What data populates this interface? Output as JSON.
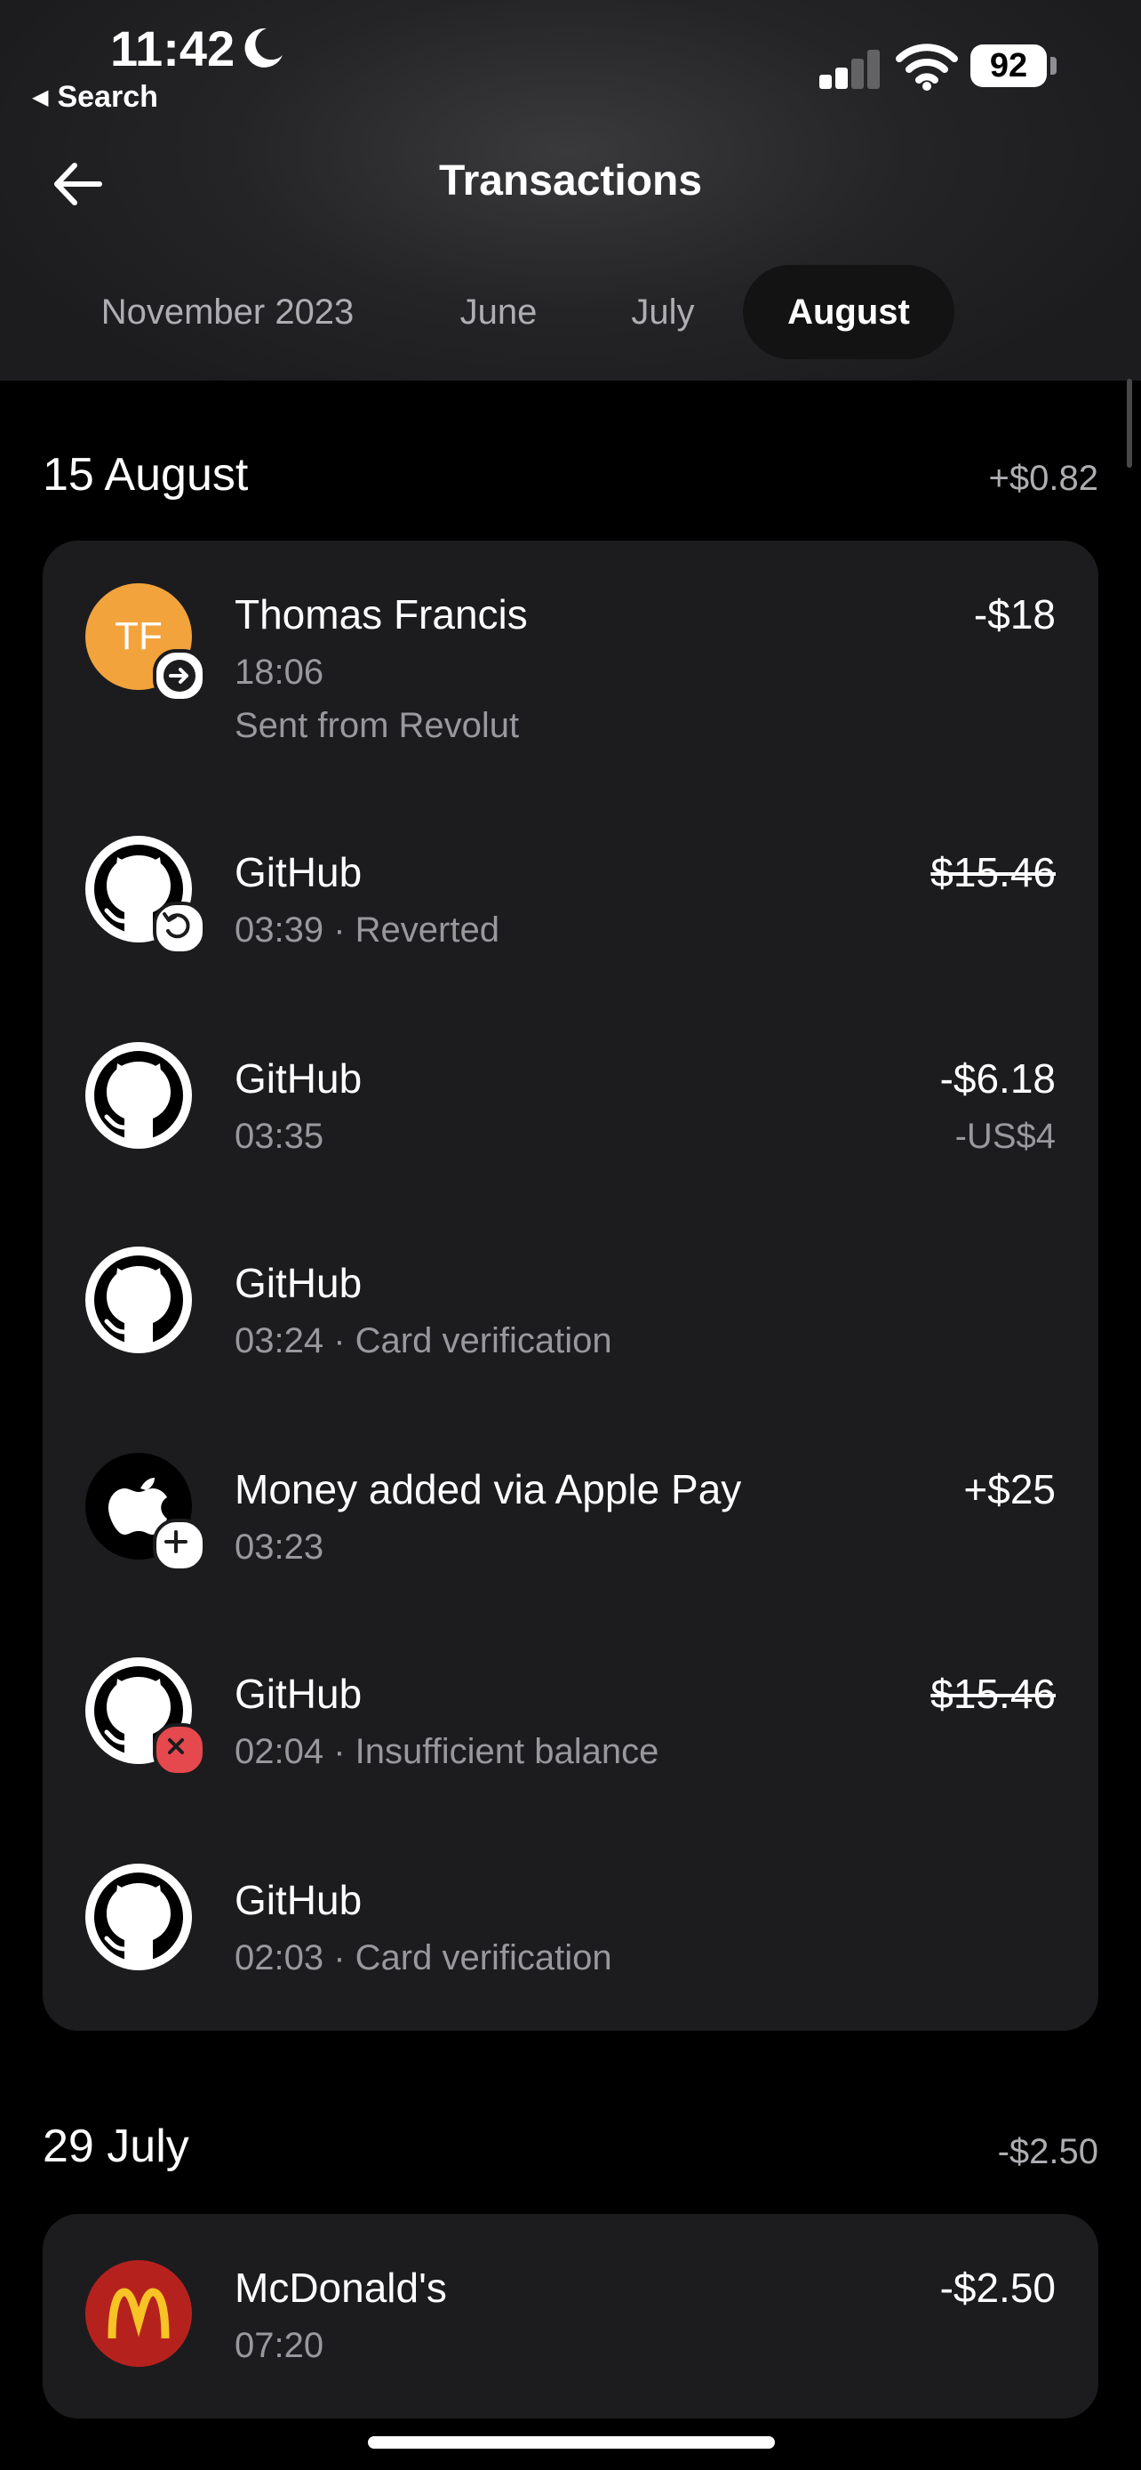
{
  "status_bar": {
    "time": "11:42",
    "back_label": "Search",
    "battery": "92"
  },
  "header": {
    "title": "Transactions"
  },
  "tabs": [
    {
      "label": "November 2023",
      "active": false
    },
    {
      "label": "June",
      "active": false
    },
    {
      "label": "July",
      "active": false
    },
    {
      "label": "August",
      "active": true
    }
  ],
  "sections": [
    {
      "date": "15 August",
      "total": "+$0.82",
      "items": [
        {
          "name": "Thomas Francis",
          "line1": "18:06",
          "line2": "Sent from Revolut",
          "amount": "-$18",
          "avatar": "TF",
          "icon": "arrow-right-badge-icon"
        },
        {
          "name": "GitHub",
          "line1": "03:39 · Reverted",
          "amount": "$15.46",
          "icon": "revert-badge-icon"
        },
        {
          "name": "GitHub",
          "line1": "03:35",
          "amount": "-$6.18",
          "amount2": "-US$4"
        },
        {
          "name": "GitHub",
          "line1": "03:24 · Card verification"
        },
        {
          "name": "Money added via Apple Pay",
          "line1": "03:23",
          "amount": "+$25",
          "icon": "plus-badge-icon"
        },
        {
          "name": "GitHub",
          "line1": "02:04 · Insufficient balance",
          "amount": "$15.46",
          "icon": "declined-badge-icon"
        },
        {
          "name": "GitHub",
          "line1": "02:03 · Card verification"
        }
      ]
    },
    {
      "date": "29 July",
      "total": "-$2.50",
      "items": [
        {
          "name": "McDonald's",
          "line1": "07:20",
          "amount": "-$2.50"
        }
      ]
    }
  ],
  "colors": {
    "accent_orange": "#f2a33c",
    "mcdonalds_red": "#b5221e",
    "mcdonalds_yellow": "#f7c325",
    "decline_red": "#e5484d"
  }
}
